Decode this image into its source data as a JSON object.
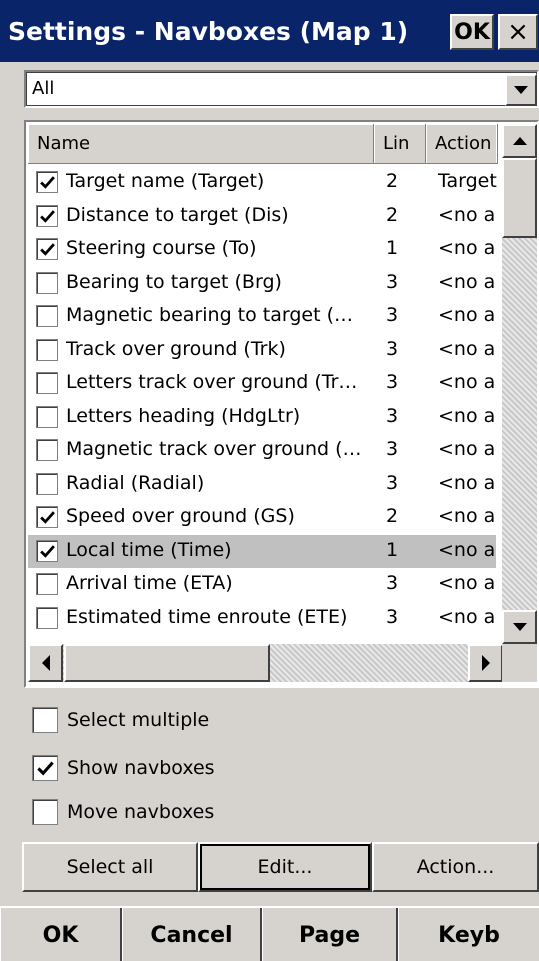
{
  "window": {
    "title": "Settings - Navboxes (Map 1)",
    "ok_label": "OK",
    "close_label": "×"
  },
  "filter": {
    "value": "All"
  },
  "list": {
    "columns": [
      "Name",
      "Lin",
      "Action"
    ],
    "rows": [
      {
        "name": "Target name (Target)",
        "lin": "2",
        "action": "Target",
        "checked": true
      },
      {
        "name": "Distance to target (Dis)",
        "lin": "2",
        "action": "<no a",
        "checked": true
      },
      {
        "name": "Steering course (To)",
        "lin": "1",
        "action": "<no a",
        "checked": true
      },
      {
        "name": "Bearing to target (Brg)",
        "lin": "3",
        "action": "<no a",
        "checked": false
      },
      {
        "name": "Magnetic bearing to target (…",
        "lin": "3",
        "action": "<no a",
        "checked": false
      },
      {
        "name": "Track over ground (Trk)",
        "lin": "3",
        "action": "<no a",
        "checked": false
      },
      {
        "name": "Letters track over ground (Tr…",
        "lin": "3",
        "action": "<no a",
        "checked": false
      },
      {
        "name": "Letters heading (HdgLtr)",
        "lin": "3",
        "action": "<no a",
        "checked": false
      },
      {
        "name": "Magnetic track over ground (…",
        "lin": "3",
        "action": "<no a",
        "checked": false
      },
      {
        "name": "Radial (Radial)",
        "lin": "3",
        "action": "<no a",
        "checked": false
      },
      {
        "name": "Speed over ground (GS)",
        "lin": "2",
        "action": "<no a",
        "checked": true
      },
      {
        "name": "Local time (Time)",
        "lin": "1",
        "action": "<no a",
        "checked": true,
        "selected": true
      },
      {
        "name": "Arrival time (ETA)",
        "lin": "3",
        "action": "<no a",
        "checked": false
      },
      {
        "name": "Estimated time enroute (ETE)",
        "lin": "3",
        "action": "<no a",
        "checked": false
      }
    ]
  },
  "options": {
    "select_multiple": {
      "label": "Select multiple",
      "checked": false
    },
    "show_navboxes": {
      "label": "Show navboxes",
      "checked": true
    },
    "move_navboxes": {
      "label": "Move navboxes",
      "checked": false
    }
  },
  "buttons": {
    "select_all": "Select all",
    "edit": "Edit...",
    "action": "Action..."
  },
  "softkeys": {
    "ok": "OK",
    "cancel": "Cancel",
    "page": "Page",
    "keyb": "Keyb"
  }
}
